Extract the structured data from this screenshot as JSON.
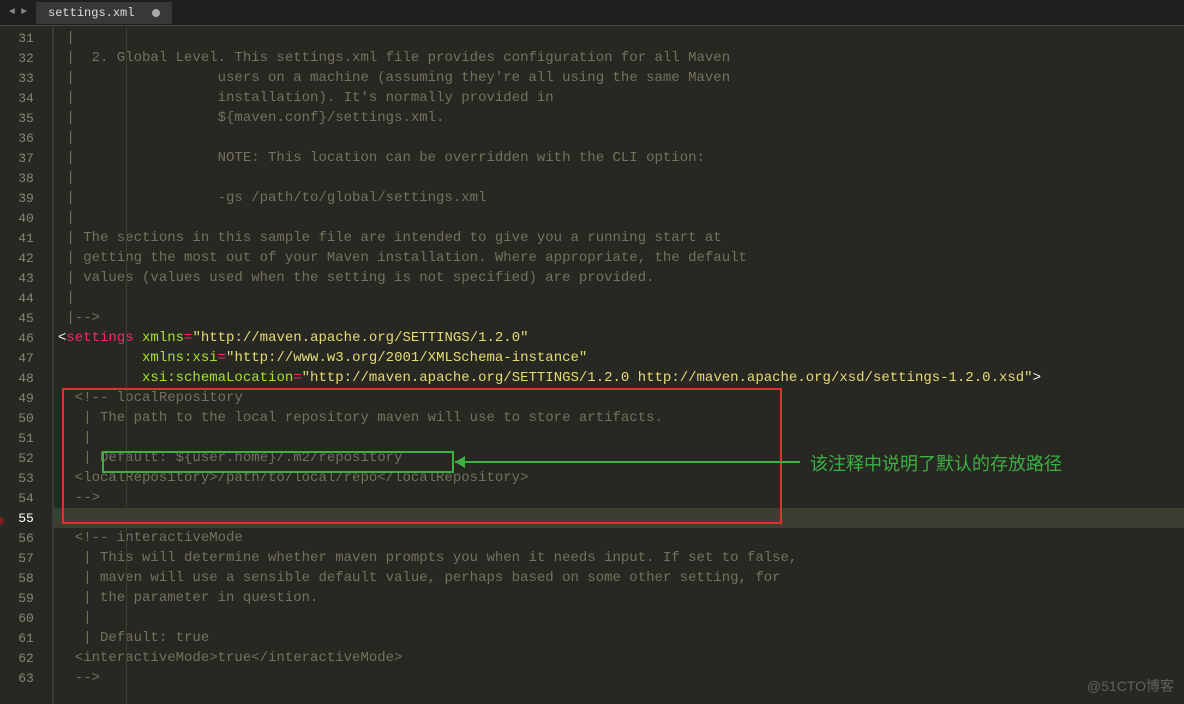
{
  "tab": {
    "filename": "settings.xml"
  },
  "watermark": "@51CTO博客",
  "annotation": "该注释中说明了默认的存放路径",
  "gutter": {
    "start": 31,
    "end": 63,
    "active": 55
  },
  "lines": [
    {
      "n": 31,
      "seg": [
        {
          "cls": "c-comment",
          "t": " |"
        }
      ]
    },
    {
      "n": 32,
      "seg": [
        {
          "cls": "c-comment",
          "t": " |  2. Global Level. This settings.xml file provides configuration for all Maven"
        }
      ]
    },
    {
      "n": 33,
      "seg": [
        {
          "cls": "c-comment",
          "t": " |                 users on a machine (assuming they're all using the same Maven"
        }
      ]
    },
    {
      "n": 34,
      "seg": [
        {
          "cls": "c-comment",
          "t": " |                 installation). It's normally provided in"
        }
      ]
    },
    {
      "n": 35,
      "seg": [
        {
          "cls": "c-comment",
          "t": " |                 ${maven.conf}/settings.xml."
        }
      ]
    },
    {
      "n": 36,
      "seg": [
        {
          "cls": "c-comment",
          "t": " |"
        }
      ]
    },
    {
      "n": 37,
      "seg": [
        {
          "cls": "c-comment",
          "t": " |                 NOTE: This location can be overridden with the CLI option:"
        }
      ]
    },
    {
      "n": 38,
      "seg": [
        {
          "cls": "c-comment",
          "t": " |"
        }
      ]
    },
    {
      "n": 39,
      "seg": [
        {
          "cls": "c-comment",
          "t": " |                 -gs /path/to/global/settings.xml"
        }
      ]
    },
    {
      "n": 40,
      "seg": [
        {
          "cls": "c-comment",
          "t": " |"
        }
      ]
    },
    {
      "n": 41,
      "seg": [
        {
          "cls": "c-comment",
          "t": " | The sections in this sample file are intended to give you a running start at"
        }
      ]
    },
    {
      "n": 42,
      "seg": [
        {
          "cls": "c-comment",
          "t": " | getting the most out of your Maven installation. Where appropriate, the default"
        }
      ]
    },
    {
      "n": 43,
      "seg": [
        {
          "cls": "c-comment",
          "t": " | values (values used when the setting is not specified) are provided."
        }
      ]
    },
    {
      "n": 44,
      "seg": [
        {
          "cls": "c-comment",
          "t": " |"
        }
      ]
    },
    {
      "n": 45,
      "seg": [
        {
          "cls": "c-comment",
          "t": " |-->"
        }
      ]
    },
    {
      "n": 46,
      "seg": [
        {
          "cls": "c-bracket",
          "t": "<"
        },
        {
          "cls": "c-tag",
          "t": "settings"
        },
        {
          "cls": "c-white",
          "t": " "
        },
        {
          "cls": "c-attr",
          "t": "xmlns"
        },
        {
          "cls": "c-op",
          "t": "="
        },
        {
          "cls": "c-str",
          "t": "\"http://maven.apache.org/SETTINGS/1.2.0\""
        }
      ]
    },
    {
      "n": 47,
      "seg": [
        {
          "cls": "c-white",
          "t": "          "
        },
        {
          "cls": "c-attr",
          "t": "xmlns:xsi"
        },
        {
          "cls": "c-op",
          "t": "="
        },
        {
          "cls": "c-str",
          "t": "\"http://www.w3.org/2001/XMLSchema-instance\""
        }
      ]
    },
    {
      "n": 48,
      "seg": [
        {
          "cls": "c-white",
          "t": "          "
        },
        {
          "cls": "c-attr",
          "t": "xsi:schemaLocation"
        },
        {
          "cls": "c-op",
          "t": "="
        },
        {
          "cls": "c-str",
          "t": "\"http://maven.apache.org/SETTINGS/1.2.0 http://maven.apache.org/xsd/settings-1.2.0.xsd\""
        },
        {
          "cls": "c-bracket",
          "t": ">"
        }
      ]
    },
    {
      "n": 49,
      "seg": [
        {
          "cls": "c-comment",
          "t": "  <!-- localRepository"
        }
      ]
    },
    {
      "n": 50,
      "seg": [
        {
          "cls": "c-comment",
          "t": "   | The path to the local repository maven will use to store artifacts."
        }
      ]
    },
    {
      "n": 51,
      "seg": [
        {
          "cls": "c-comment",
          "t": "   |"
        }
      ]
    },
    {
      "n": 52,
      "seg": [
        {
          "cls": "c-comment",
          "t": "   | Default: ${user.home}/.m2/repository"
        }
      ]
    },
    {
      "n": 53,
      "seg": [
        {
          "cls": "c-comment",
          "t": "  <localRepository>/path/to/local/repo</localRepository>"
        }
      ]
    },
    {
      "n": 54,
      "seg": [
        {
          "cls": "c-comment",
          "t": "  -->"
        }
      ]
    },
    {
      "n": 55,
      "seg": [],
      "active": true
    },
    {
      "n": 56,
      "seg": [
        {
          "cls": "c-comment",
          "t": "  <!-- interactiveMode"
        }
      ]
    },
    {
      "n": 57,
      "seg": [
        {
          "cls": "c-comment",
          "t": "   | This will determine whether maven prompts you when it needs input. If set to false,"
        }
      ]
    },
    {
      "n": 58,
      "seg": [
        {
          "cls": "c-comment",
          "t": "   | maven will use a sensible default value, perhaps based on some other setting, for"
        }
      ]
    },
    {
      "n": 59,
      "seg": [
        {
          "cls": "c-comment",
          "t": "   | the parameter in question."
        }
      ]
    },
    {
      "n": 60,
      "seg": [
        {
          "cls": "c-comment",
          "t": "   |"
        }
      ]
    },
    {
      "n": 61,
      "seg": [
        {
          "cls": "c-comment",
          "t": "   | Default: true"
        }
      ]
    },
    {
      "n": 62,
      "seg": [
        {
          "cls": "c-comment",
          "t": "  <interactiveMode>true</interactiveMode>"
        }
      ]
    },
    {
      "n": 63,
      "seg": [
        {
          "cls": "c-comment",
          "t": "  -->"
        }
      ]
    }
  ]
}
